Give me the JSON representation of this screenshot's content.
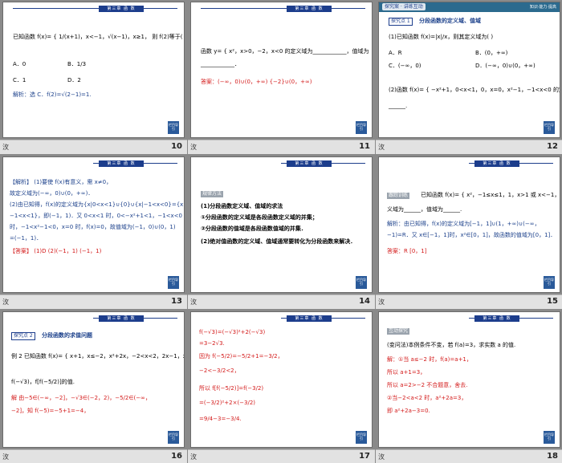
{
  "common": {
    "chapter_label": "第三章 函 数",
    "nav_label": "栏目导引",
    "strip_mark": "㳊"
  },
  "slides": [
    {
      "number": "10",
      "lines": [
        "已知函数 f(x)= { 1/(x+1)，x<−1，√(x−1)，x≥1， 则 f(2)等于(   )",
        "A．0",
        "B．1/3",
        "C．1",
        "D．2",
        "解析：选 C．f(2)=√(2−1)=1."
      ]
    },
    {
      "number": "11",
      "lines": [
        "函数 y= { x²，x>0，−2，x<0 的定义域为____________，值域为",
        "____________．",
        "答案：(−∞，0)∪(0，+∞)   {−2}∪(0，+∞)"
      ]
    },
    {
      "number": "12",
      "header": "探究案 · 讲练互动",
      "header_right": "知识·能力·提高",
      "section": "探究点 1",
      "section_title": "分段函数的定义域、值域",
      "lines": [
        "(1)已知函数 f(x)=|x|/x，则其定义域为(   )",
        "A．R",
        "B．(0，+∞)",
        "C．(−∞，0)",
        "D．(−∞，0)∪(0，+∞)",
        "(2)函数 f(x)= { −x²+1，0<x<1，0，x=0，x²−1，−1<x<0 的定义域为______，值域为",
        "______."
      ]
    },
    {
      "number": "13",
      "lines": [
        "【解析】 (1)要使 f(x)有意义，需 x≠0，",
        "故定义域为(−∞，0)∪(0，+∞)．",
        "(2)由已知得，f(x)的定义域为{x|0<x<1}∪{0}∪{x|−1<x<0}={x|",
        "−1<x<1}，即(−1，1)．又 0<x<1 时，0<−x²+1<1，−1<x<0",
        "时，−1<x²−1<0，x=0 时，f(x)=0，故值域为(−1，0)∪(0，1)",
        "=(−1，1)．",
        "【答案】 (1)D  (2)(−1，1)  (−1，1)"
      ]
    },
    {
      "number": "14",
      "tag": "规律方法",
      "lines": [
        "(1)分段函数定义域、值域的求法",
        "①分段函数的定义域是各段函数定义域的并集；",
        "②分段函数的值域是各段函数值域的并集．",
        "(2)绝对值函数的定义域、值域通常要转化为分段函数来解决．"
      ]
    },
    {
      "number": "15",
      "tag": "跟踪训练",
      "lines": [
        "已知函数 f(x)= { x²，−1≤x≤1，1，x>1 或 x<−1， 则函数的定",
        "义域为______，值域为______.",
        "解析：由已知得，f(x)的定义域为[−1，1]∪(1，+∞)∪(−∞，",
        "−1)=R．又 x∈[−1，1]时，x²∈[0，1]，故函数的值域为[0，1]．",
        "答案：R  [0，1]"
      ]
    },
    {
      "number": "16",
      "section": "探究点 2",
      "section_title": "分段函数的求值问题",
      "lines": [
        "例 2  已知函数 f(x)= { x+1，x≤−2，x²+2x，−2<x<2，2x−1，x≥2. 试求 f(−5)，",
        "f(−√3)，f[f(−5/2)]的值.",
        "解  由−5∈(−∞，−2]，−√3∈(−2，2)，−5/2∈(−∞，",
        "−2]，知 f(−5)=−5+1=−4，"
      ]
    },
    {
      "number": "17",
      "lines": [
        "f(−√3)=(−√3)²+2(−√3)",
        "=3−2√3.",
        "因为 f(−5/2)=−5/2+1=−3/2，",
        "−2<−3/2<2，",
        "所以 f[f(−5/2)]=f(−3/2)",
        "=(−3/2)²+2×(−3/2)",
        "=9/4−3=−3/4."
      ]
    },
    {
      "number": "18",
      "tag": "互动探究",
      "lines": [
        "(变问法)本例条件不变，若 f(a)=3，求实数 a 的值.",
        "解：①当 a≤−2 时，f(a)=a+1，",
        "所以 a+1=3，",
        "所以 a=2>−2 不合题意，舍去.",
        "②当−2<a<2 时，a²+2a=3，",
        "即 a²+2a−3=0."
      ]
    }
  ]
}
